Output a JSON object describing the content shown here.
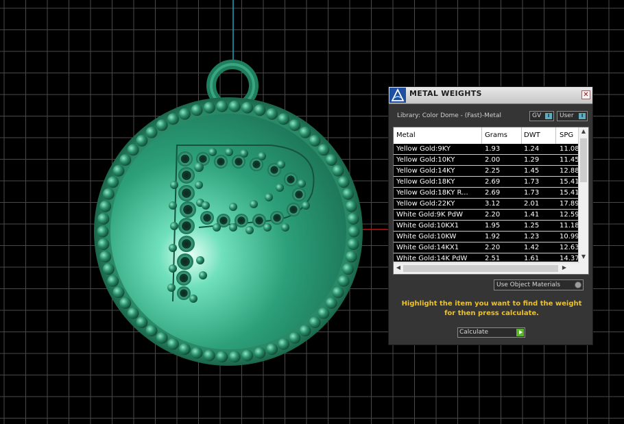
{
  "panel": {
    "title": "METAL WEIGHTS",
    "close_glyph": "✕",
    "library_label": "Library: Color Dome - (Fast)-Metal",
    "chips": [
      {
        "label": "GV",
        "icon": "info-icon"
      },
      {
        "label": "User",
        "icon": "info-icon"
      }
    ],
    "chip_icon_glyph": "I",
    "table": {
      "headers": [
        "Metal",
        "Grams",
        "DWT",
        "SPG"
      ],
      "rows": [
        {
          "metal": "Yellow Gold:9KY",
          "grams": "1.93",
          "dwt": "1.24",
          "spg": "11.08"
        },
        {
          "metal": "Yellow Gold:10KY",
          "grams": "2.00",
          "dwt": "1.29",
          "spg": "11.45"
        },
        {
          "metal": "Yellow Gold:14KY",
          "grams": "2.25",
          "dwt": "1.45",
          "spg": "12.88"
        },
        {
          "metal": "Yellow Gold:18KY",
          "grams": "2.69",
          "dwt": "1.73",
          "spg": "15.41"
        },
        {
          "metal": "Yellow Gold:18KY R...",
          "grams": "2.69",
          "dwt": "1.73",
          "spg": "15.41"
        },
        {
          "metal": "Yellow Gold:22KY",
          "grams": "3.12",
          "dwt": "2.01",
          "spg": "17.89"
        },
        {
          "metal": "White Gold:9K PdW",
          "grams": "2.20",
          "dwt": "1.41",
          "spg": "12.59"
        },
        {
          "metal": "White Gold:10KX1",
          "grams": "1.95",
          "dwt": "1.25",
          "spg": "11.18"
        },
        {
          "metal": "White Gold:10KW",
          "grams": "1.92",
          "dwt": "1.23",
          "spg": "10.99"
        },
        {
          "metal": "White Gold:14KX1",
          "grams": "2.20",
          "dwt": "1.42",
          "spg": "12.63"
        },
        {
          "metal": "White Gold:14K PdW",
          "grams": "2.51",
          "dwt": "1.61",
          "spg": "14.37"
        }
      ]
    },
    "scroll_arrows": {
      "up": "▲",
      "down": "▼",
      "left": "◀",
      "right": "▶"
    },
    "use_object_materials": "Use Object Materials",
    "hint": "Highlight the item you want to find the weight for then press calculate.",
    "calculate_label": "Calculate"
  },
  "colors": {
    "model_green": "#2f9a73",
    "hint_text": "#f2c21c",
    "axis_x": "#c01414",
    "axis_y": "#1aa6c4",
    "grid": "#4a4a4a"
  }
}
